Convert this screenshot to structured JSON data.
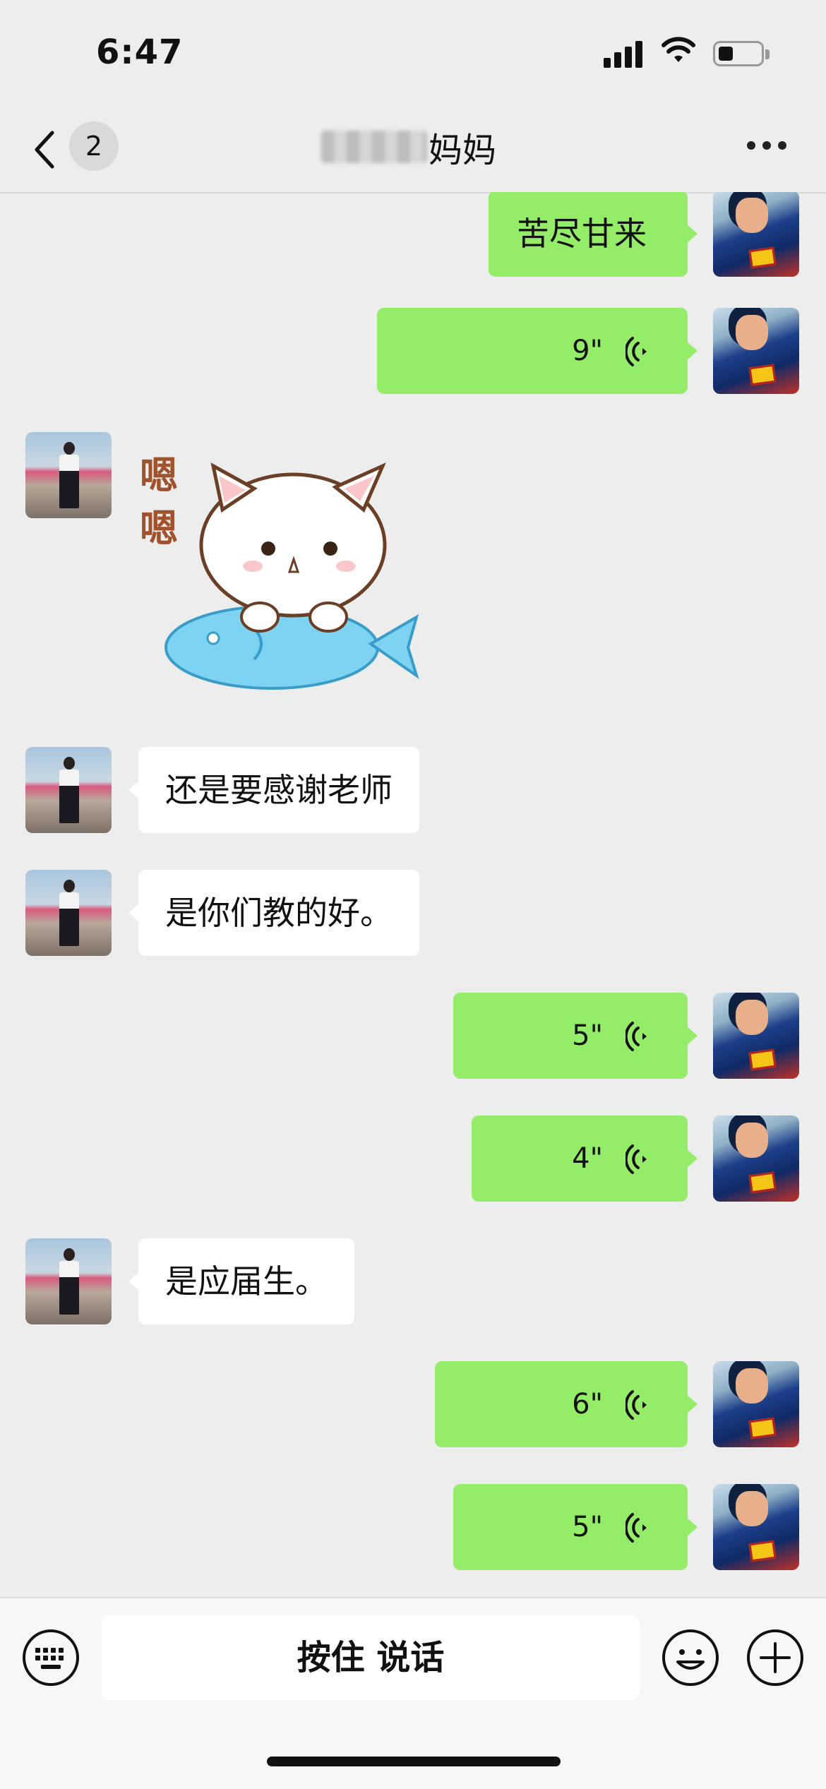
{
  "status_bar": {
    "time": "6:47"
  },
  "nav": {
    "unread_count": "2",
    "title": "妈妈"
  },
  "messages": [
    {
      "sender": "me",
      "type": "text",
      "text": "苦尽甘来"
    },
    {
      "sender": "me",
      "type": "voice",
      "duration": "9\""
    },
    {
      "sender": "contact",
      "type": "sticker",
      "text": "嗯嗯",
      "icon": "cat-on-fish-sticker"
    },
    {
      "sender": "contact",
      "type": "text",
      "text": "还是要感谢老师"
    },
    {
      "sender": "contact",
      "type": "text",
      "text": "是你们教的好。"
    },
    {
      "sender": "me",
      "type": "voice",
      "duration": "5\""
    },
    {
      "sender": "me",
      "type": "voice",
      "duration": "4\""
    },
    {
      "sender": "contact",
      "type": "text",
      "text": "是应届生。"
    },
    {
      "sender": "me",
      "type": "voice",
      "duration": "6\""
    },
    {
      "sender": "me",
      "type": "voice",
      "duration": "5\""
    }
  ],
  "input_bar": {
    "talk_label": "按住 说话"
  },
  "colors": {
    "background": "#ededed",
    "outgoing_bubble": "#95ec69",
    "incoming_bubble": "#ffffff"
  }
}
